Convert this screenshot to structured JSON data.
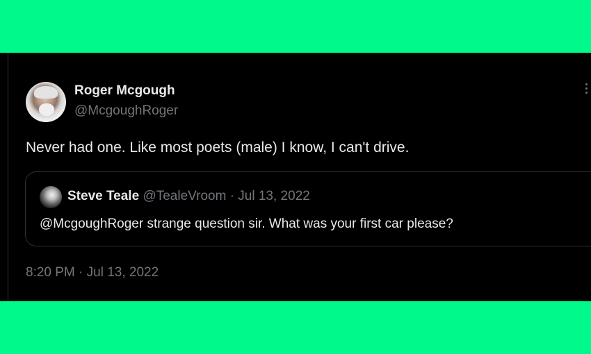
{
  "background_color": "#00f98b",
  "tweet": {
    "author": {
      "name": "Roger Mcgough",
      "handle": "@McgoughRoger",
      "avatar_icon": "profile-photo"
    },
    "more_icon": "more-options-icon",
    "text": "Never had one. Like most poets (male) I know, I can't drive.",
    "timestamp": "8:20 PM · Jul 13, 2022",
    "quoted": {
      "name": "Steve Teale",
      "handle": "@TealeVroom",
      "separator": "·",
      "date": "Jul 13, 2022",
      "text": "@McgoughRoger strange question sir. What was your first car please?",
      "avatar_icon": "profile-photo"
    }
  }
}
